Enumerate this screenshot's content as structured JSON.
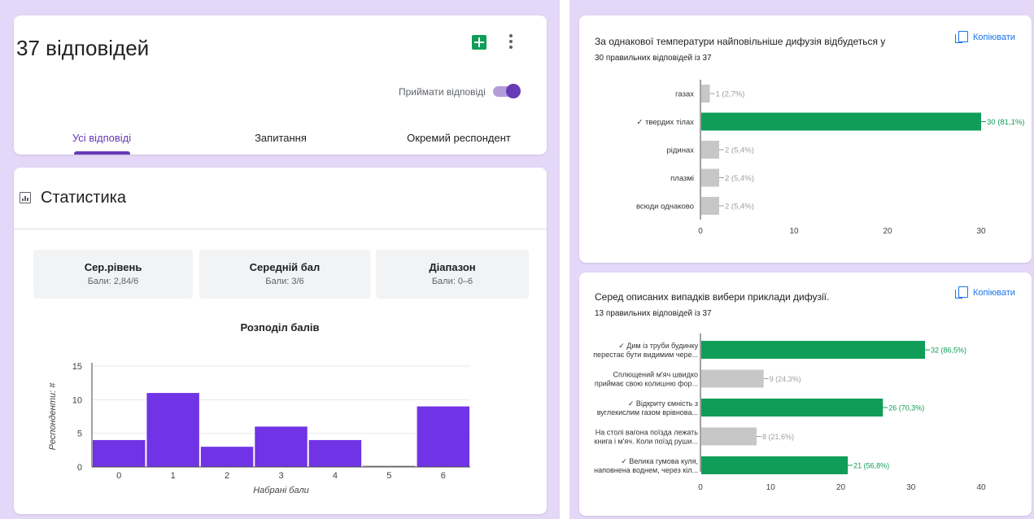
{
  "summary": {
    "response_count_title": "37 відповідей",
    "accept_label": "Приймати відповіді",
    "accepting": true,
    "tabs": [
      {
        "label": "Усі відповіді",
        "active": true
      },
      {
        "label": "Запитання",
        "active": false
      },
      {
        "label": "Окремий респондент",
        "active": false
      }
    ]
  },
  "stats": {
    "title": "Статистика",
    "metrics": [
      {
        "name": "Сер.рівень",
        "value": "Бали: 2,84/6"
      },
      {
        "name": "Середній бал",
        "value": "Бали: 3/6"
      },
      {
        "name": "Діапазон",
        "value": "Бали: 0–6"
      }
    ]
  },
  "questions": [
    {
      "title": "За однакової температури найповільніше дифузія відбудеться у",
      "correct_text": "30 правильних відповідей із 37",
      "copy_label": "Копіювати"
    },
    {
      "title": "Серед описаних випадків вибери приклади дифузії.",
      "correct_text": "13 правильних відповідей із 37",
      "copy_label": "Копіювати"
    }
  ],
  "colors": {
    "accent": "#673ab7",
    "bar_purple": "#7033e6",
    "correct": "#0f9d58",
    "incorrect": "#c7c7c7"
  },
  "chart_data": [
    {
      "type": "bar",
      "title": "Розподіл балів",
      "xlabel": "Набрані бали",
      "ylabel": "Респонденти: #",
      "categories": [
        "0",
        "1",
        "2",
        "3",
        "4",
        "5",
        "6"
      ],
      "values": [
        4,
        11,
        3,
        6,
        4,
        0,
        9
      ],
      "ylim": [
        0,
        15
      ],
      "yticks": [
        "0",
        "5",
        "10",
        "15"
      ],
      "grid": true
    },
    {
      "type": "bar",
      "orientation": "horizontal",
      "categories": [
        "газах",
        "✓ твердих тілах",
        "рідинах",
        "плазмі",
        "всюди однаково"
      ],
      "values": [
        1,
        30,
        2,
        2,
        2
      ],
      "labels": [
        "1 (2,7%)",
        "30 (81,1%)",
        "2 (5,4%)",
        "2 (5,4%)",
        "2 (5,4%)"
      ],
      "correct": [
        false,
        true,
        false,
        false,
        false
      ],
      "xlim": [
        0,
        30
      ],
      "xticks": [
        "0",
        "10",
        "20",
        "30"
      ]
    },
    {
      "type": "bar",
      "orientation": "horizontal",
      "categories": [
        [
          "✓ Дим із труби будинку",
          "перестає бути видимим чере..."
        ],
        [
          "Сплющений м'яч швидко",
          "приймає свою колишню фор..."
        ],
        [
          "✓ Відкриту ємність з",
          "вуглекислим газом врівнова..."
        ],
        [
          "На столі вагона поїзда лежать",
          "книга і м'яч. Коли поїзд руши..."
        ],
        [
          "✓ Велика гумова куля,",
          "наповнена воднем, через кіл..."
        ]
      ],
      "values": [
        32,
        9,
        26,
        8,
        21
      ],
      "labels": [
        "32 (86,5%)",
        "9 (24,3%)",
        "26 (70,3%)",
        "8 (21,6%)",
        "21 (56,8%)"
      ],
      "correct": [
        true,
        false,
        true,
        false,
        true
      ],
      "xlim": [
        0,
        40
      ],
      "xticks": [
        "0",
        "10",
        "20",
        "30",
        "40"
      ]
    }
  ]
}
